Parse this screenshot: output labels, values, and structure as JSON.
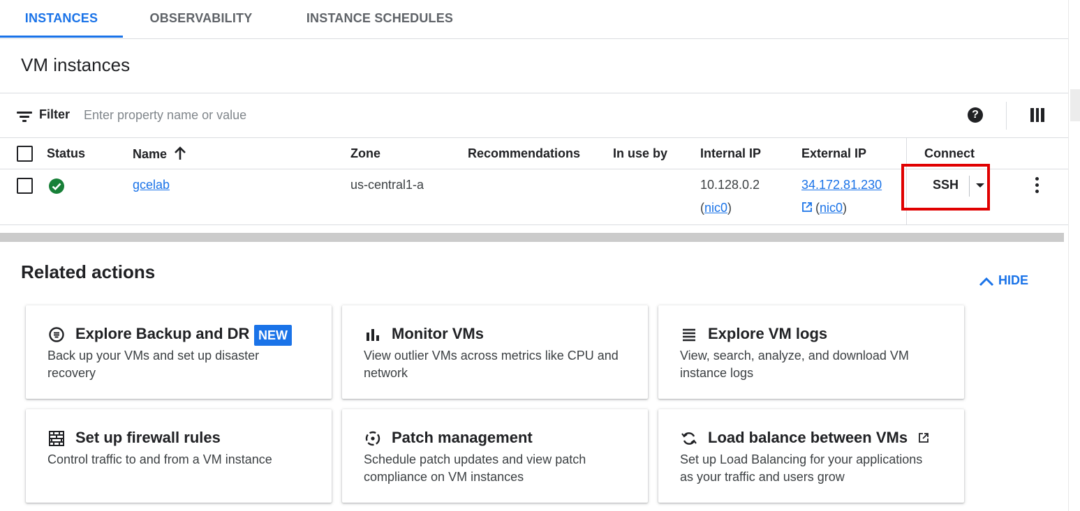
{
  "tabs": [
    {
      "label": "INSTANCES",
      "active": true
    },
    {
      "label": "OBSERVABILITY",
      "active": false
    },
    {
      "label": "INSTANCE SCHEDULES",
      "active": false
    }
  ],
  "page": {
    "title": "VM instances"
  },
  "filter": {
    "label": "Filter",
    "placeholder": "Enter property name or value",
    "help_icon": "help-icon",
    "columns_icon": "column-display-icon"
  },
  "table": {
    "headers": {
      "status": "Status",
      "name": "Name",
      "zone": "Zone",
      "recommendations": "Recommendations",
      "in_use_by": "In use by",
      "internal_ip": "Internal IP",
      "external_ip": "External IP",
      "connect": "Connect"
    },
    "sort": {
      "column": "Name",
      "direction": "ascending"
    },
    "rows": [
      {
        "status": "running",
        "status_icon": "check-circle-icon",
        "name": "gcelab",
        "zone": "us-central1-a",
        "recommendations": "",
        "in_use_by": "",
        "internal_ip": "10.128.0.2",
        "internal_nic": "nic0",
        "external_ip": "34.172.81.230",
        "external_nic": "nic0",
        "connect_label": "SSH"
      }
    ]
  },
  "related": {
    "title": "Related actions",
    "hide_label": "HIDE",
    "cards": [
      {
        "icon": "backup-icon",
        "title": "Explore Backup and DR",
        "badge": "NEW",
        "desc": "Back up your VMs and set up disaster recovery"
      },
      {
        "icon": "bar-chart-icon",
        "title": "Monitor VMs",
        "desc": "View outlier VMs across metrics like CPU and network"
      },
      {
        "icon": "logs-icon",
        "title": "Explore VM logs",
        "desc": "View, search, analyze, and download VM instance logs"
      },
      {
        "icon": "firewall-icon",
        "title": "Set up firewall rules",
        "desc": "Control traffic to and from a VM instance"
      },
      {
        "icon": "patch-icon",
        "title": "Patch management",
        "desc": "Schedule patch updates and view patch compliance on VM instances"
      },
      {
        "icon": "load-balance-icon",
        "title": "Load balance between VMs",
        "external": true,
        "desc": "Set up Load Balancing for your applications as your traffic and users grow"
      }
    ]
  },
  "colors": {
    "accent": "#1a73e8",
    "success": "#188038",
    "highlight": "#e00000"
  }
}
